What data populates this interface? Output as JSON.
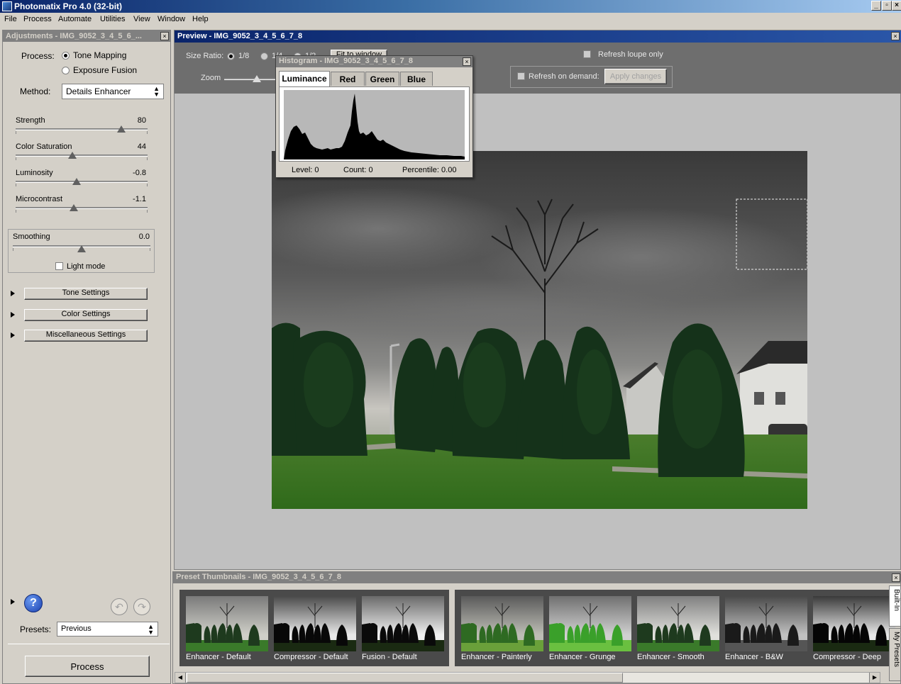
{
  "window": {
    "title": "Photomatix Pro 4.0 (32-bit)",
    "buttons": [
      "_",
      "▫",
      "×"
    ]
  },
  "menu": [
    "File",
    "Process",
    "Automate",
    "Utilities",
    "View",
    "Window",
    "Help"
  ],
  "adjustments": {
    "title": "Adjustments - IMG_9052_3_4_5_6_...",
    "process_label": "Process:",
    "process_options": [
      "Tone Mapping",
      "Exposure Fusion"
    ],
    "process_selected": "Tone Mapping",
    "method_label": "Method:",
    "method_value": "Details Enhancer",
    "sliders": [
      {
        "label": "Strength",
        "value": "80",
        "fraction": 0.8
      },
      {
        "label": "Color Saturation",
        "value": "44",
        "fraction": 0.43
      },
      {
        "label": "Luminosity",
        "value": "-0.8",
        "fraction": 0.46
      },
      {
        "label": "Microcontrast",
        "value": "-1.1",
        "fraction": 0.44
      }
    ],
    "smoothing": {
      "label": "Smoothing",
      "value": "0.0",
      "fraction": 0.5
    },
    "light_mode_label": "Light mode",
    "sections": [
      "Tone Settings",
      "Color Settings",
      "Miscellaneous Settings"
    ],
    "presets_label": "Presets:",
    "presets_value": "Previous",
    "process_button": "Process",
    "help_glyph": "?"
  },
  "preview": {
    "title": "Preview - IMG_9052_3_4_5_6_7_8",
    "size_ratio_label": "Size Ratio:",
    "size_ratio_options": [
      "1/8",
      "1/4",
      "1/2"
    ],
    "fit_label": "Fit to window",
    "zoom_label": "Zoom",
    "refresh_loupe_label": "Refresh loupe only",
    "refresh_demand_label": "Refresh on demand:",
    "apply_changes_label": "Apply changes"
  },
  "histogram": {
    "title": "Histogram - IMG_9052_3_4_5_6_7_8",
    "tabs": [
      "Luminance",
      "Red",
      "Green",
      "Blue"
    ],
    "active_tab": "Luminance",
    "level": "Level: 0",
    "count": "Count: 0",
    "percentile": "Percentile: 0.00"
  },
  "thumbnails": {
    "title": "Preset Thumbnails - IMG_9052_3_4_5_6_7_8",
    "builtin_tab": "Built-In",
    "mypresets_tab": "My Presets",
    "group1": [
      "Enhancer - Default",
      "Compressor - Default",
      "Fusion - Default"
    ],
    "group2": [
      "Enhancer - Painterly",
      "Enhancer - Grunge",
      "Enhancer - Smooth",
      "Enhancer - B&W",
      "Compressor - Deep"
    ]
  },
  "colors": {
    "titlebar": "#0a246a",
    "panel": "#d4d0c8",
    "help_blue": "#2050c0",
    "grass": "#3f7a24",
    "trees": "#142e12"
  }
}
